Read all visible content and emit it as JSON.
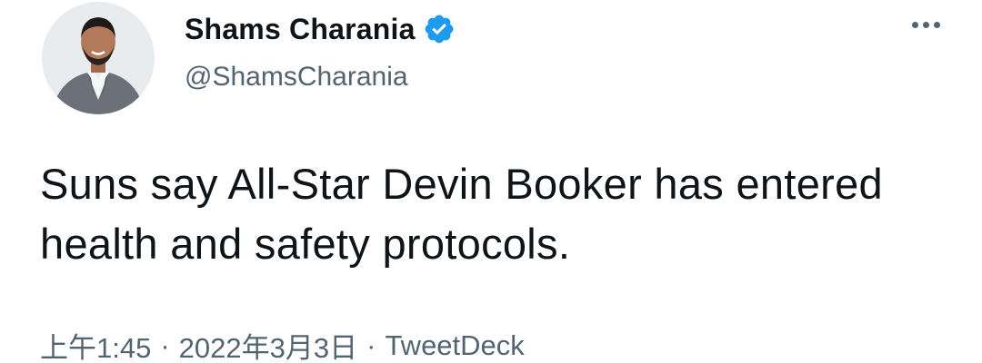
{
  "tweet": {
    "author": {
      "display_name": "Shams Charania",
      "handle": "@ShamsCharania",
      "verified": true,
      "verified_icon": "verified-badge-icon",
      "avatar_icon": "avatar-photo"
    },
    "more_icon": "more-options-icon",
    "text": "Suns say All-Star Devin Booker has entered health and safety protocols.",
    "meta": {
      "time": "上午1:45",
      "separator": "·",
      "date": "2022年3月3日",
      "source": "TweetDeck"
    }
  },
  "colors": {
    "text_primary": "#0f1419",
    "text_secondary": "#536471",
    "verified_blue": "#1d9bf0",
    "background": "#ffffff"
  }
}
